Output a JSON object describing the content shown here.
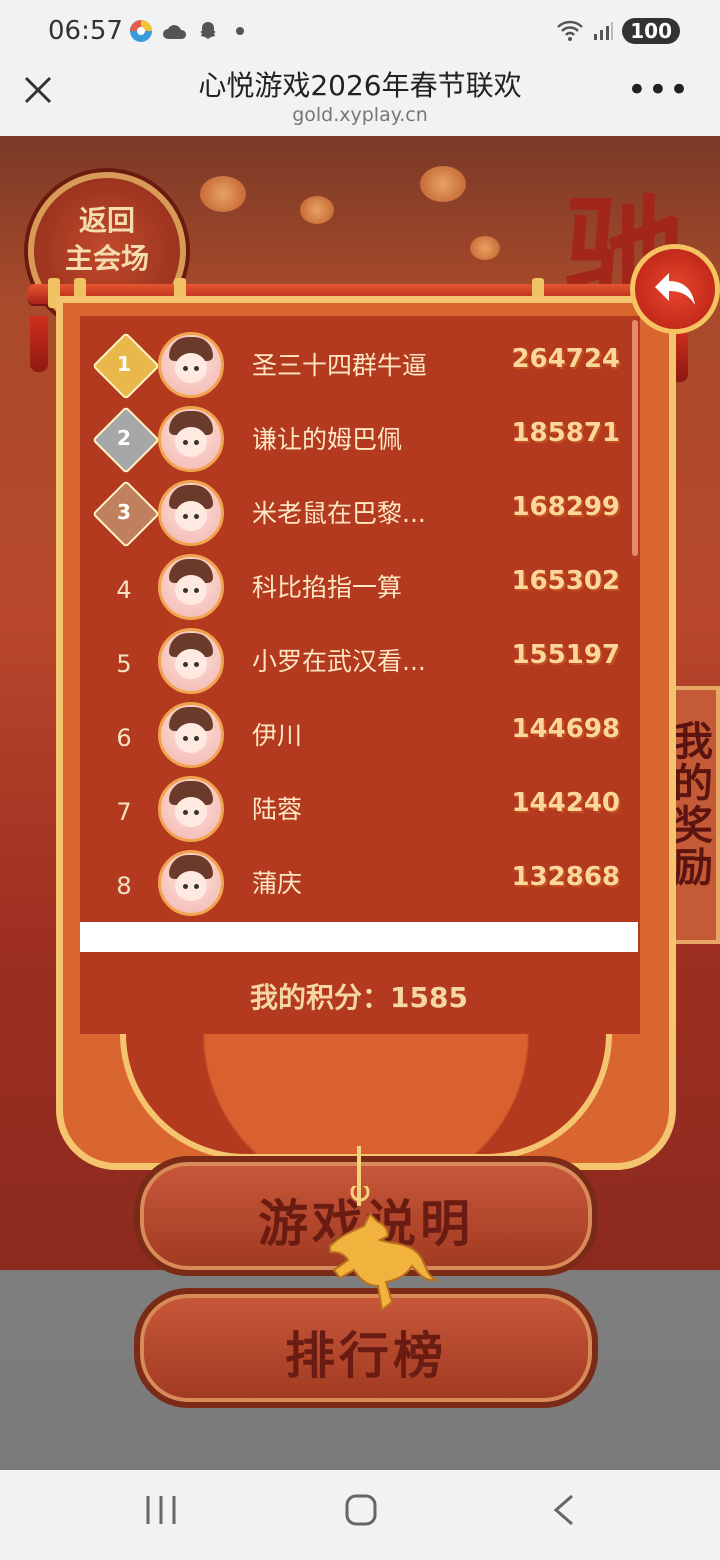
{
  "status_bar": {
    "time": "06:57",
    "battery": "100"
  },
  "browser": {
    "title": "心悦游戏2026年春节联欢",
    "url": "gold.xyplay.cn"
  },
  "scene": {
    "return_text": [
      "返回",
      "主会场"
    ],
    "banner_char": "驰",
    "my_rewards": "我的奖励"
  },
  "leaderboard": {
    "rows": [
      {
        "rank": "1",
        "name": "圣三十四群牛逼",
        "score": "264724",
        "medal": "#e9b84a"
      },
      {
        "rank": "2",
        "name": "谦让的姆巴佩",
        "score": "185871",
        "medal": "#a7a7a7"
      },
      {
        "rank": "3",
        "name": "米老鼠在巴黎...",
        "score": "168299",
        "medal": "#c0805d"
      },
      {
        "rank": "4",
        "name": "科比掐指一算",
        "score": "165302"
      },
      {
        "rank": "5",
        "name": "小罗在武汉看...",
        "score": "155197"
      },
      {
        "rank": "6",
        "name": "伊川",
        "score": "144698"
      },
      {
        "rank": "7",
        "name": "陆蓉",
        "score": "144240"
      },
      {
        "rank": "8",
        "name": "蒲庆",
        "score": "132868"
      }
    ],
    "my_score_label": "我的积分：",
    "my_score_value": "1585"
  },
  "buttons": {
    "instructions": "游戏说明",
    "ranking": "排行榜"
  }
}
